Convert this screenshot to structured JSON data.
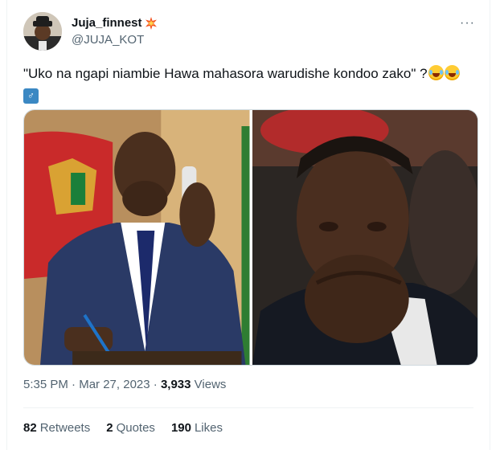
{
  "tweet": {
    "display_name": "Juja_finnest",
    "name_badge_icon": "collision-emoji-icon",
    "handle": "@JUJA_KOT",
    "more_menu": "···",
    "text": "\"Uko na ngapi niambie Hawa mahasora warudishe kondoo zako\" ?",
    "emoji": [
      "face-with-tears-of-joy",
      "face-with-tears-of-joy",
      "man-symbol-emoji"
    ],
    "time": "5:35 PM",
    "separator": "·",
    "date": "Mar 27, 2023",
    "views_count": "3,933",
    "views_label": "Views",
    "retweets_count": "82",
    "retweets_label": "Retweets",
    "quotes_count": "2",
    "quotes_label": "Quotes",
    "likes_count": "190",
    "likes_label": "Likes"
  },
  "colors": {
    "text_primary": "#0f1419",
    "text_secondary": "#536471",
    "border": "#cfd9de",
    "divider": "#eff3f4"
  }
}
